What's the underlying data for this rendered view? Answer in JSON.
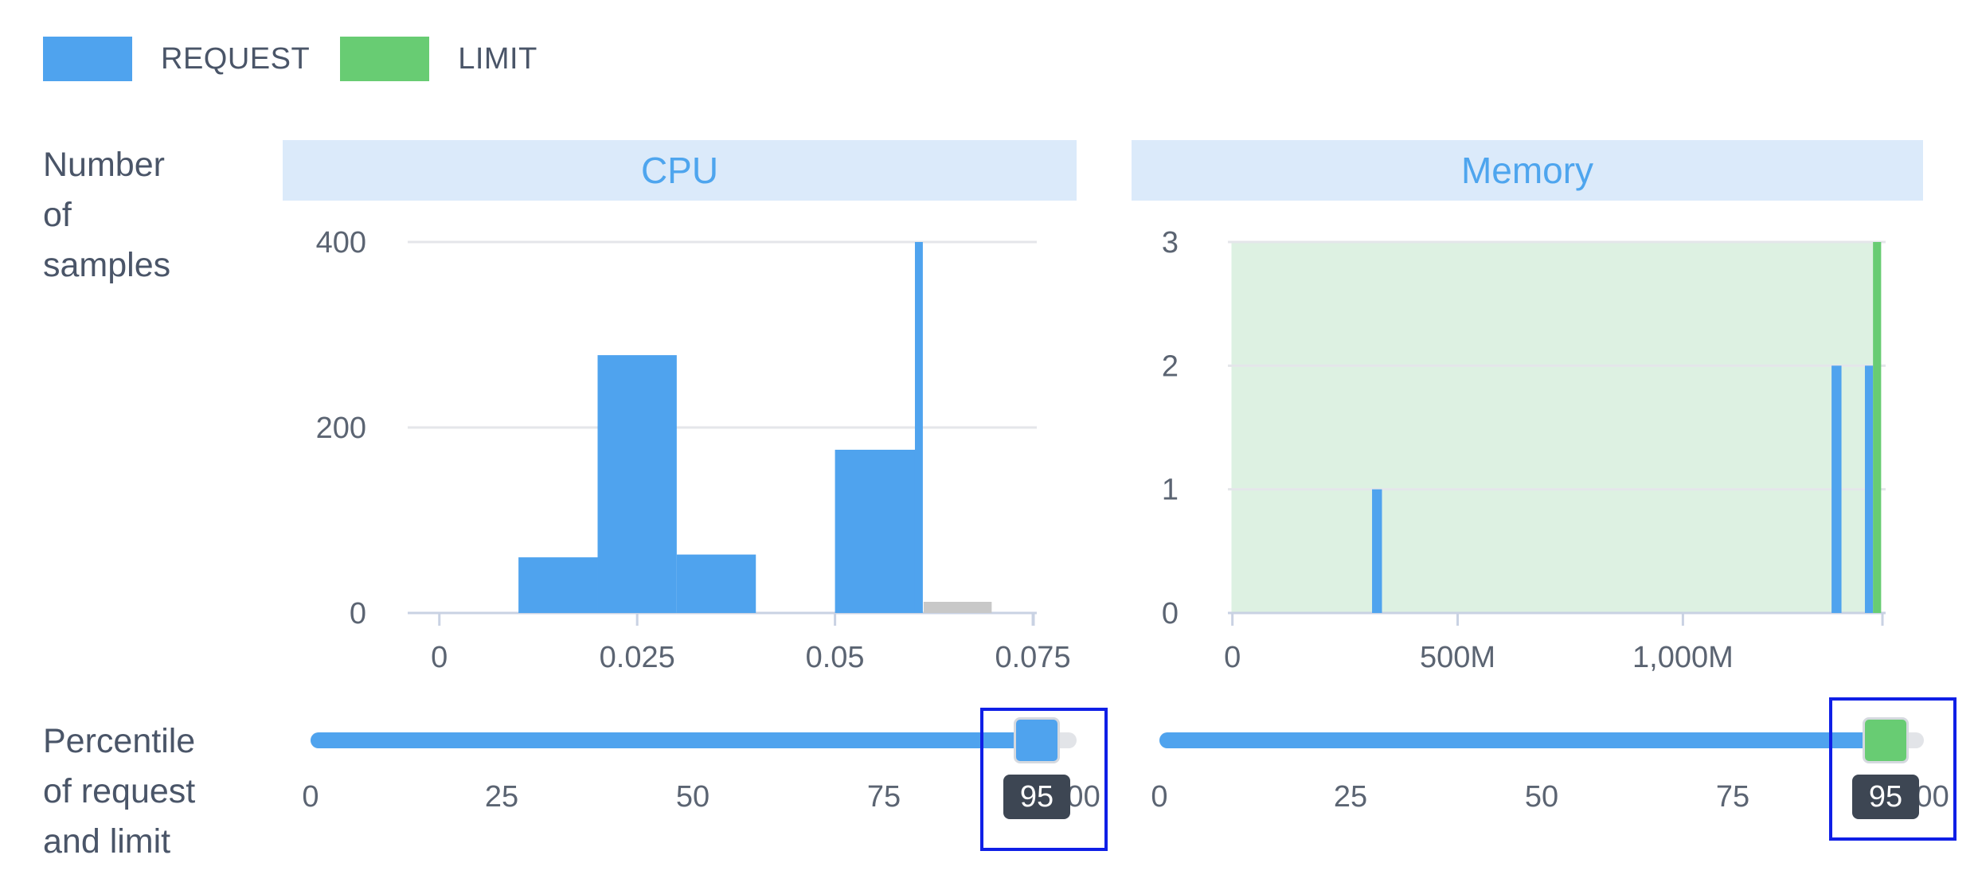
{
  "legend": {
    "items": [
      {
        "label": "REQUEST",
        "color": "#4fa3ee"
      },
      {
        "label": "LIMIT",
        "color": "#68cc73"
      }
    ]
  },
  "row_labels": {
    "samples": [
      "Number",
      "of",
      "samples"
    ],
    "percentile": [
      "Percentile",
      "of request",
      "and limit"
    ]
  },
  "chart_data": [
    {
      "type": "bar",
      "title": "CPU",
      "ylabel": "Number of samples",
      "xlim": [
        -0.004,
        0.0755
      ],
      "ylim": [
        0,
        400
      ],
      "x_ticks": [
        {
          "value": 0,
          "label": "0"
        },
        {
          "value": 0.025,
          "label": "0.025"
        },
        {
          "value": 0.05,
          "label": "0.05"
        },
        {
          "value": 0.075,
          "label": "0.075"
        }
      ],
      "y_ticks": [
        {
          "value": 0,
          "label": "0"
        },
        {
          "value": 200,
          "label": "200"
        },
        {
          "value": 400,
          "label": "400"
        }
      ],
      "series": [
        {
          "name": "REQUEST",
          "color": "#4fa3ee",
          "bins": [
            {
              "x0": 0.01,
              "x1": 0.02,
              "y": 60
            },
            {
              "x0": 0.02,
              "x1": 0.03,
              "y": 278
            },
            {
              "x0": 0.03,
              "x1": 0.04,
              "y": 63
            },
            {
              "x0": 0.05,
              "x1": 0.061,
              "y": 176
            },
            {
              "x0": 0.0601,
              "x1": 0.0611,
              "y": 400
            }
          ]
        },
        {
          "color": "#c8c8c8",
          "bins": [
            {
              "x0": 0.0612,
              "x1": 0.0698,
              "y": 12
            }
          ]
        }
      ]
    },
    {
      "type": "bar",
      "title": "Memory",
      "ylabel": "Number of samples",
      "xlim": [
        -10,
        1450
      ],
      "ylim": [
        0,
        3
      ],
      "x_ticks": [
        {
          "value": 0,
          "label": "0"
        },
        {
          "value": 500,
          "label": "500M"
        },
        {
          "value": 1000,
          "label": "1,000M"
        }
      ],
      "y_ticks": [
        {
          "value": 0,
          "label": "0"
        },
        {
          "value": 1,
          "label": "1"
        },
        {
          "value": 2,
          "label": "2"
        },
        {
          "value": 3,
          "label": "3"
        }
      ],
      "shaded_region": {
        "x0": -2,
        "x1": 1440,
        "color": "#ddf1e2"
      },
      "series": [
        {
          "name": "REQUEST",
          "color": "#4fa3ee",
          "bins": [
            {
              "x0": 310,
              "x1": 332,
              "y": 1
            },
            {
              "x0": 1330,
              "x1": 1352,
              "y": 2
            },
            {
              "x0": 1404,
              "x1": 1422,
              "y": 2
            }
          ]
        },
        {
          "name": "LIMIT",
          "color": "#68cc73",
          "bins": [
            {
              "x0": 1422,
              "x1": 1440,
              "y": 3
            }
          ]
        }
      ]
    }
  ],
  "sliders": [
    {
      "name": "cpu-percentile-slider",
      "value": 95,
      "ticks": [
        "0",
        "25",
        "50",
        "75",
        "100"
      ],
      "fill_color": "#4fa3ee",
      "thumb_color": "#4fa3ee",
      "tooltip": "95"
    },
    {
      "name": "memory-percentile-slider",
      "value": 95,
      "ticks": [
        "0",
        "25",
        "50",
        "75",
        "100"
      ],
      "fill_color": "#4fa3ee",
      "thumb_color": "#68cc73",
      "tooltip": "95"
    }
  ]
}
